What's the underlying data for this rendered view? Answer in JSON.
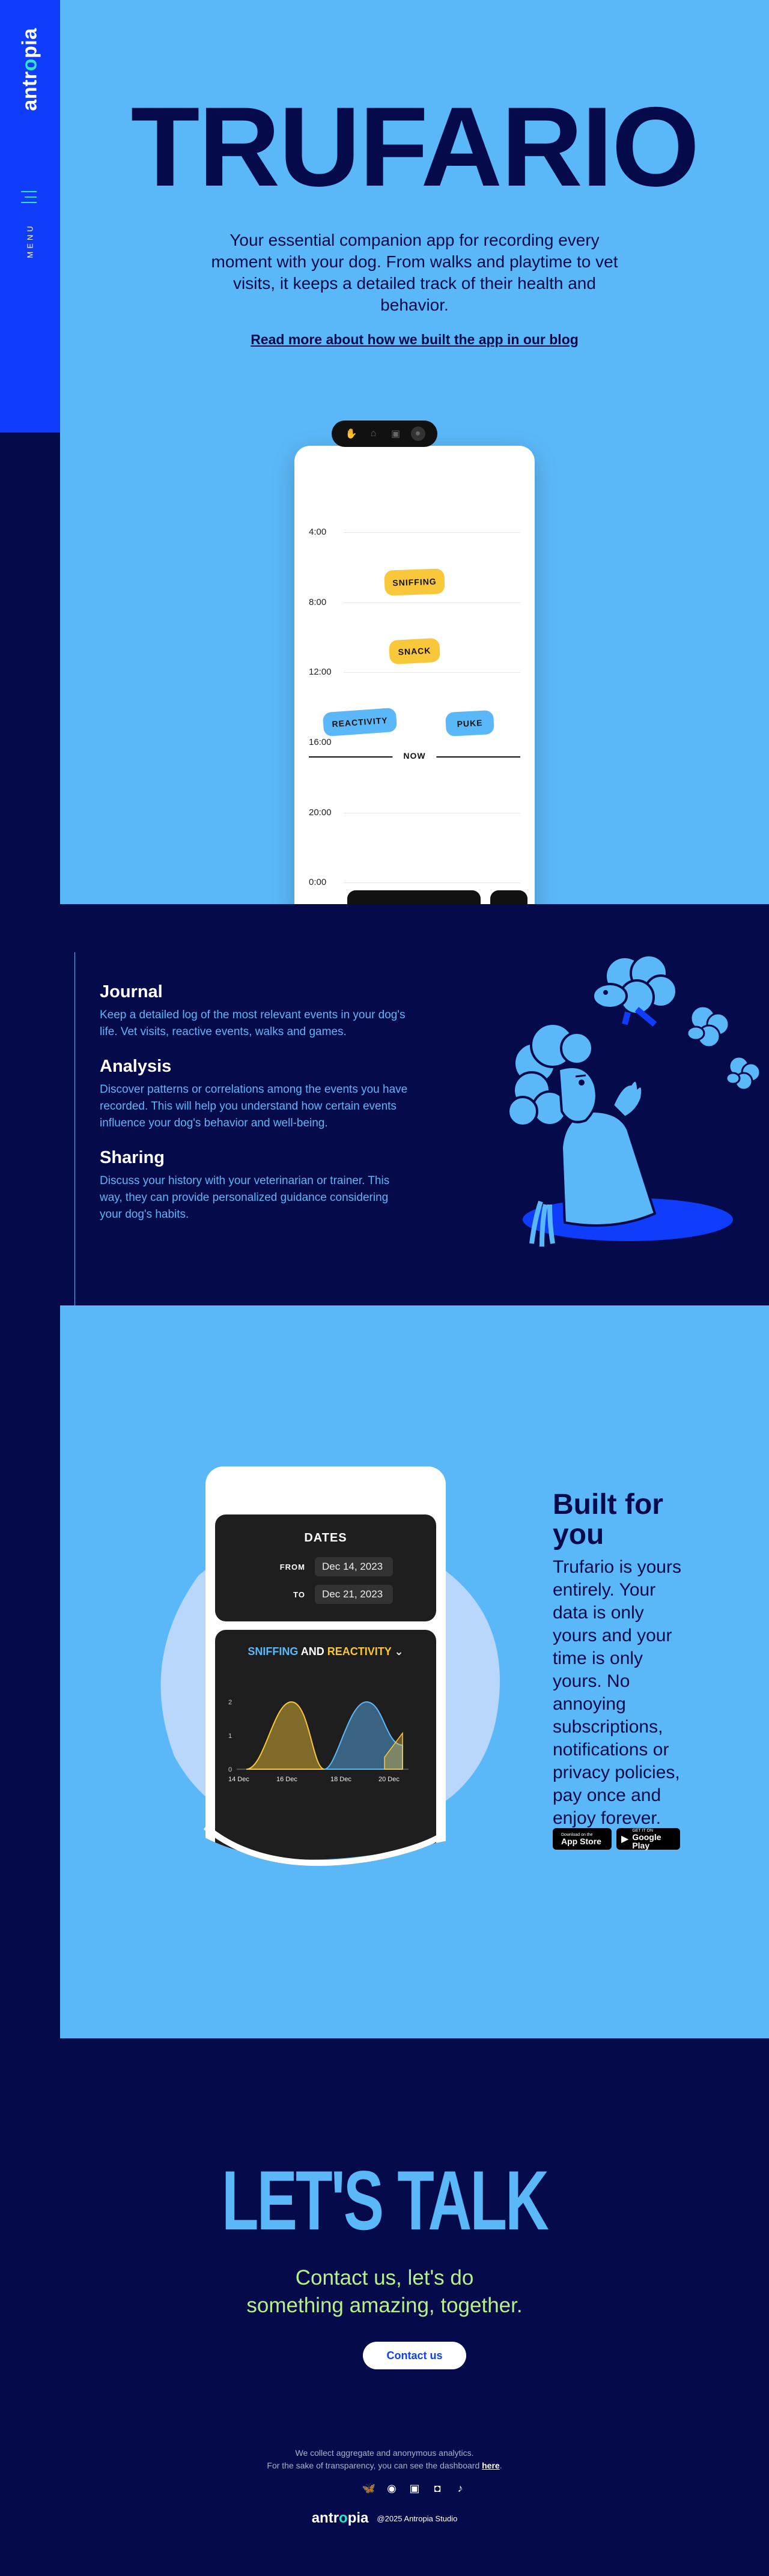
{
  "brand": {
    "logo_pre": "antr",
    "logo_o": "o",
    "logo_post": "pia"
  },
  "nav": {
    "menu_label": "MENU"
  },
  "hero": {
    "title": "TRUFARIO",
    "description": "Your essential companion app for recording every moment with your dog. From walks and playtime to vet visits, it keeps a detailed track of their health and behavior.",
    "blog_link": "Read more about how we built the app in our blog"
  },
  "phone": {
    "times": [
      "4:00",
      "8:00",
      "12:00",
      "16:00",
      "20:00",
      "0:00"
    ],
    "events": [
      "SNIFFING",
      "SNACK",
      "REACTIVITY",
      "PUKE"
    ],
    "now_label": "NOW"
  },
  "features": [
    {
      "title": "Journal",
      "text": "Keep a detailed log of the most relevant events in your dog's life. Vet visits, reactive events, walks and games."
    },
    {
      "title": "Analysis",
      "text": "Discover patterns or correlations among the events you have recorded. This will help you understand how certain events influence your dog's behavior and well-being."
    },
    {
      "title": "Sharing",
      "text": "Discuss your history with your veterinarian or trainer. This way, they can provide personalized guidance considering your dog's habits."
    }
  ],
  "built": {
    "title": "Built for you",
    "description": "Trufario is yours entirely. Your data is only yours and your time is only yours. No annoying subscriptions, notifications or privacy policies, pay once and enjoy forever.",
    "app_store_small": "Download on the",
    "app_store": "App Store",
    "google_play_small": "GET IT ON",
    "google_play": "Google Play"
  },
  "dates_card": {
    "title": "DATES",
    "from_label": "FROM",
    "from_value": "Dec 14, 2023",
    "to_label": "TO",
    "to_value": "Dec 21, 2023"
  },
  "chart_data": {
    "type": "area",
    "title_part1": "SNIFFING",
    "title_and": "AND",
    "title_part2": "REACTIVITY",
    "x_ticks": [
      "14 Dec",
      "16 Dec",
      "18 Dec",
      "20 Dec"
    ],
    "y_ticks": [
      "0",
      "1",
      "2"
    ],
    "ylim": [
      0,
      2
    ],
    "colors": {
      "sniffing": "#5bb8f8",
      "reactivity": "#f9c83a"
    }
  },
  "talk": {
    "title": "LET'S TALK",
    "subtitle": "Contact us, let's do something amazing, together.",
    "button": "Contact us"
  },
  "footer": {
    "analytics_line1": "We collect aggregate and anonymous analytics.",
    "analytics_line2": "For the sake of transparency, you can see the dashboard",
    "analytics_link": "here",
    "copyright": "@2025 Antropia Studio"
  }
}
